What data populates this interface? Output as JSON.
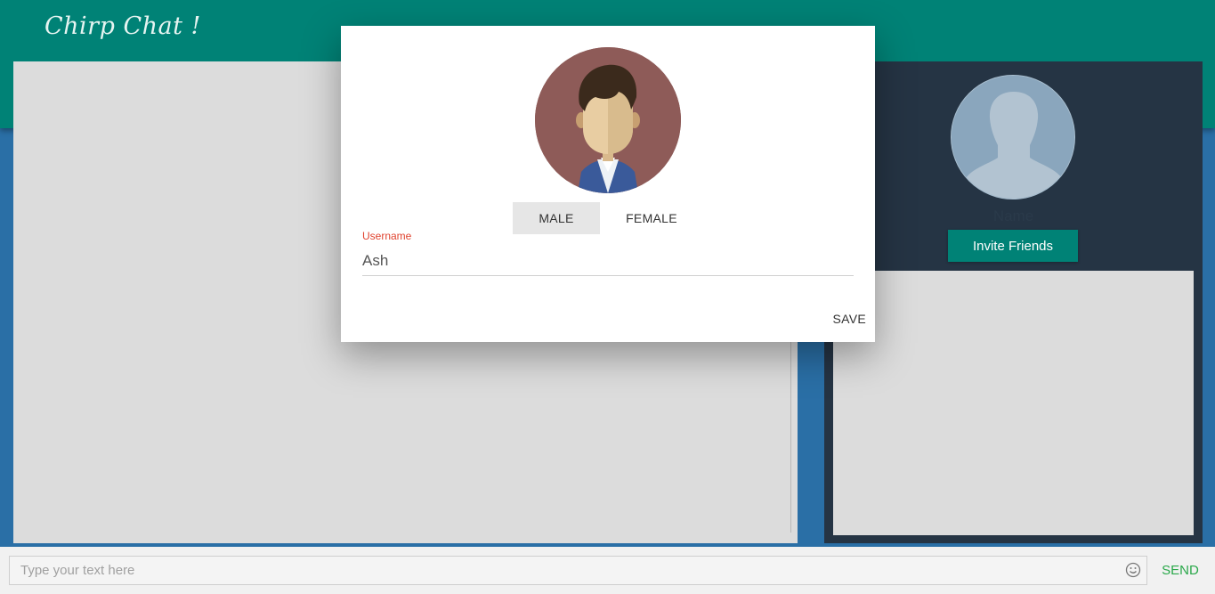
{
  "app": {
    "logo_text": "Chirp Chat !"
  },
  "side_panel": {
    "name_placeholder": "Name",
    "invite_button_label": "Invite Friends"
  },
  "composer": {
    "placeholder": "Type your text here",
    "send_label": "SEND",
    "emoji_icon": "smiley-icon"
  },
  "dialog": {
    "gender_options": [
      "MALE",
      "FEMALE"
    ],
    "selected_gender": "MALE",
    "username_label": "Username",
    "username_value": "Ash",
    "save_label": "SAVE"
  },
  "colors": {
    "brand": "#008276",
    "background": "#2a6fa6",
    "side_panel": "#253444",
    "error_label": "#e0432f",
    "send": "#2aa84a"
  }
}
